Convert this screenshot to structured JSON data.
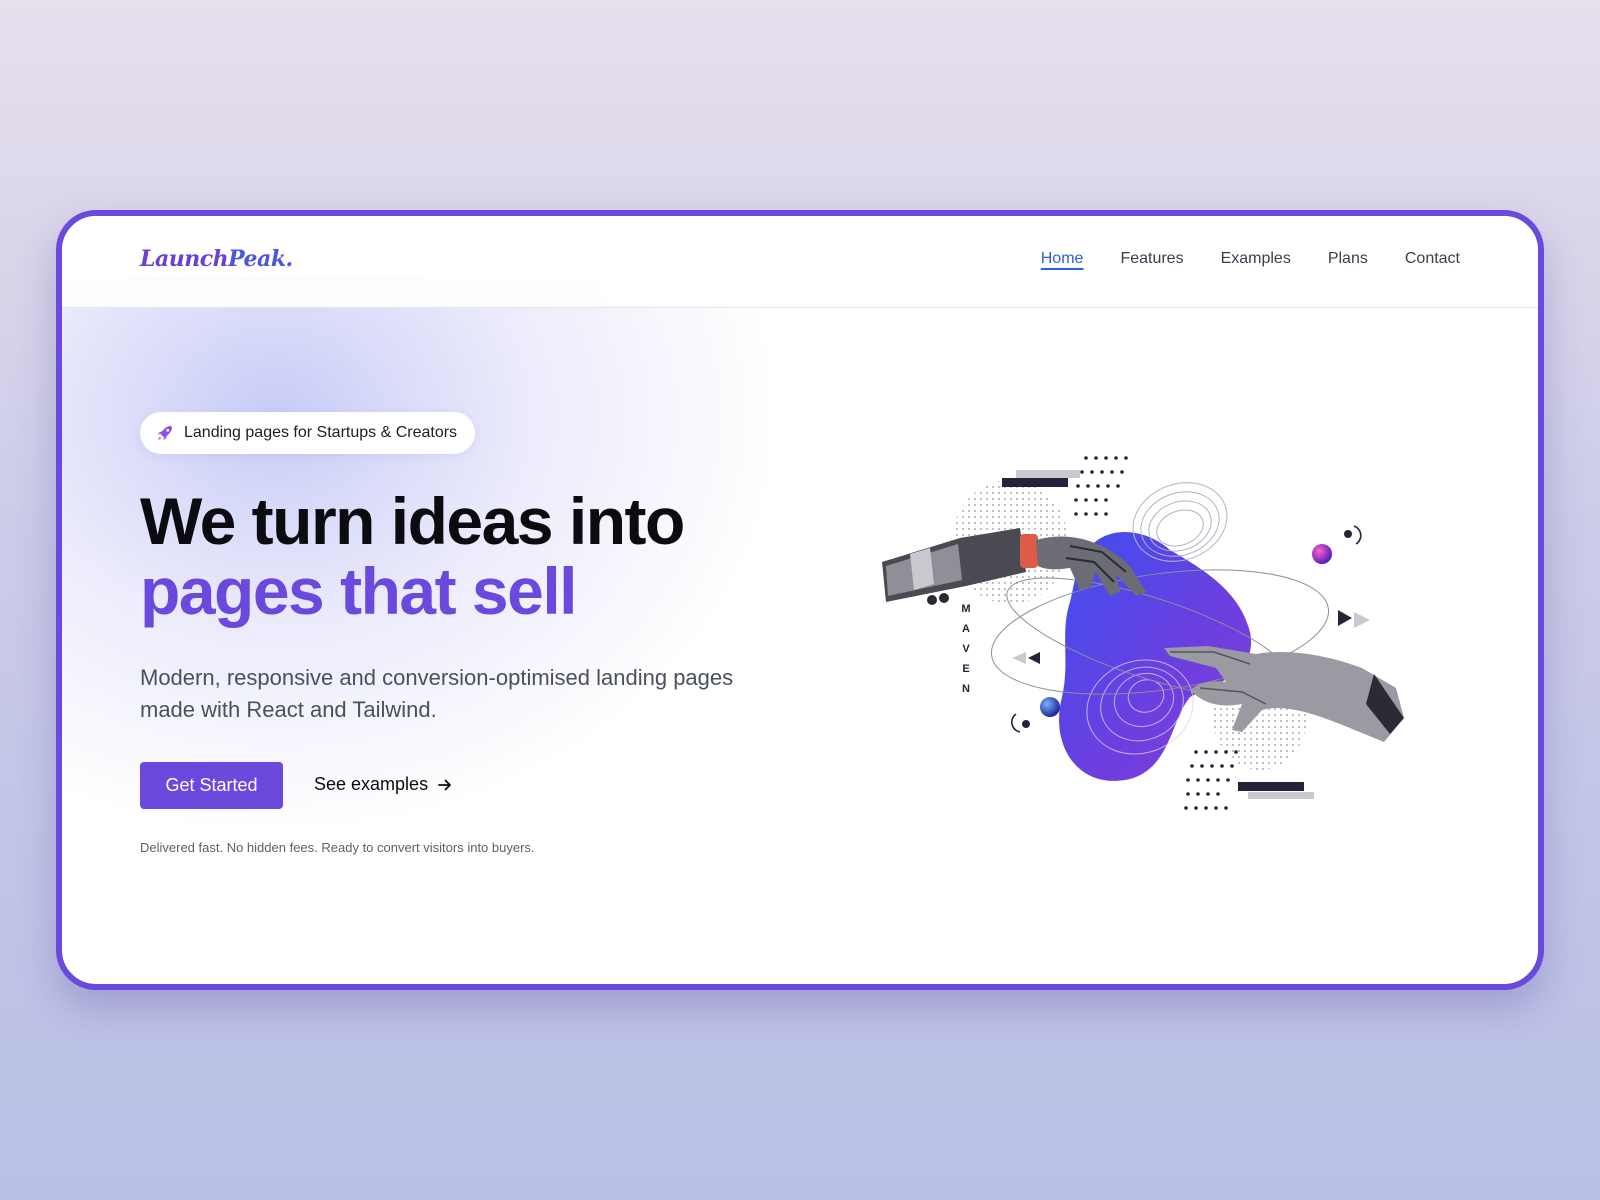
{
  "logo": {
    "part1": "Launch",
    "part2": "Peak."
  },
  "nav": {
    "items": [
      "Home",
      "Features",
      "Examples",
      "Plans",
      "Contact"
    ],
    "active": "Home"
  },
  "hero": {
    "badge": "Landing pages for Startups & Creators",
    "badge_icon": "rocket-icon",
    "headline_line1": "We turn ideas into",
    "headline_line2": "pages that sell",
    "subtitle": "Modern, responsive and conversion-optimised landing pages made with React and Tailwind.",
    "primary_cta": "Get Started",
    "secondary_cta": "See examples",
    "secondary_icon": "arrow-right-icon",
    "fine_print": "Delivered fast. No hidden fees. Ready to convert visitors into buyers.",
    "illustration_label": "MAVEN"
  },
  "colors": {
    "accent": "#6a49dc",
    "nav_active": "#2a62d6",
    "text_dark": "#0b0b10",
    "frame_border": "#6a49dc"
  }
}
